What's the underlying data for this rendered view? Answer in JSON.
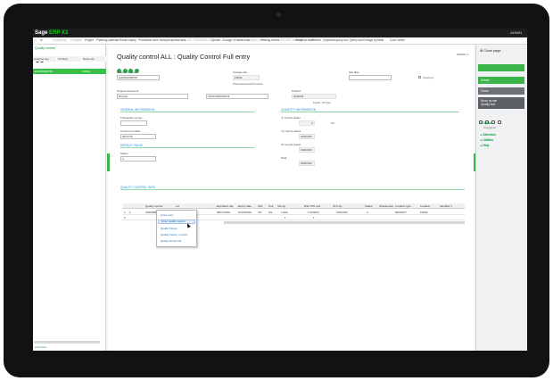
{
  "app": {
    "logo_prefix": "Sage",
    "logo_suffix": "ERP X3",
    "user": "ADMIN"
  },
  "menu": [
    {
      "label": "Customers",
      "dim": true
    },
    {
      "label": "Products",
      "dim": true
    },
    {
      "label": "Project",
      "dim": false
    },
    {
      "label": "Planning calendar",
      "dim": false
    },
    {
      "label": "Route inquiry",
      "dim": false
    },
    {
      "label": "Production work history",
      "dim": false
    },
    {
      "label": "Graphical task",
      "dim": false
    },
    {
      "label": "LIST STANDING ON",
      "dim": true
    },
    {
      "label": "Quotes",
      "dim": false
    },
    {
      "label": "Change of warehouse",
      "dim": false
    },
    {
      "label": "Creation data",
      "dim": true
    },
    {
      "label": "Picking tickets",
      "dim": false
    },
    {
      "label": "UPDATE tracking",
      "dim": true
    },
    {
      "label": "Workflow state",
      "dim": false
    },
    {
      "label": "Orders",
      "dim": false
    },
    {
      "label": "Graphical query tool",
      "dim": false
    },
    {
      "label": "Query tool",
      "dim": false
    }
  ],
  "menu_badges": [
    "Change by table",
    "Cost Center"
  ],
  "left_panel": {
    "title": "Quality control",
    "columns": [
      "Analysis req.",
      "Product",
      "Stock site"
    ],
    "selected_row": [
      "QA0000328709",
      "",
      "FR011"
    ],
    "footer": "Last rows"
  },
  "form": {
    "title": "Quality control ALL : Quality Control Full entry",
    "model_label": "MODEL",
    "analysis_request": {
      "label": "Analysis request",
      "value": "QA0000328709"
    },
    "storage_site": {
      "label": "Storage site",
      "value": "FR011",
      "sub": "Pharmaceutical Products"
    },
    "site_filter": {
      "label": "Site filter",
      "value": "",
      "option": "Inventory"
    },
    "original_document": {
      "label": "Original document",
      "type": "Receipt",
      "value": "FR011R00000278"
    },
    "product": {
      "label": "Product",
      "value": "QG0041",
      "sub": "Liquid - B Type"
    },
    "general_info": "GENERAL INFORMATION",
    "transaction_group": {
      "label": "Transaction group",
      "value": ""
    },
    "control_end_date": {
      "label": "Control end date",
      "value": "04/27/16"
    },
    "default_value": "DEFAULT VALUE",
    "status": {
      "label": "Status",
      "value": "A"
    },
    "quantity_info": "QUANTITY INFORMATION",
    "qty_a": {
      "label": "'A' control status",
      "value": "0",
      "unit": "KG"
    },
    "qty_q": {
      "label": "'Q' control status",
      "value": "1000.000"
    },
    "qty_r": {
      "label": "'R' control status",
      "value": "1000.000"
    },
    "total": {
      "label": "Total",
      "value": "1000.000"
    },
    "grid_section": "QUALITY CONTROL DATA"
  },
  "grid": {
    "columns": [
      "",
      "",
      "Quality control",
      "Lot",
      "Expiration dat",
      "Expiry date",
      "SSL",
      "Unit",
      "Stk qty",
      "RSL STK unit",
      "STK qty",
      "",
      "Status",
      "Checksmail",
      "Location type",
      "Location",
      "Identifier 1"
    ],
    "rows": [
      [
        "1",
        "",
        "A0000887",
        "L1170404203674",
        "08/17/2016",
        "07/29/2016",
        "UN",
        "KG",
        "1.000",
        "1.000000",
        "1000.000",
        "",
        "A",
        "",
        "RECEIPT",
        "FR011",
        ""
      ],
      [
        "2",
        "",
        "",
        "",
        "",
        "",
        "",
        "",
        "1",
        "1",
        "",
        "",
        "",
        "",
        "",
        "",
        ""
      ]
    ]
  },
  "popup": {
    "items": [
      "Lines entry",
      "Enter quality results",
      "Quality history",
      "Quality history / record",
      "Quality kinetic list"
    ],
    "highlight_index": 1
  },
  "right_panel": {
    "close": "Close page",
    "buttons": [
      "",
      "Delete",
      "Close"
    ],
    "dark_lines": [
      "Stock by site",
      "Quality test"
    ],
    "links": [
      {
        "label": "Option",
        "sub": "Navigation"
      },
      {
        "label": "Selection",
        "sub": ""
      },
      {
        "label": "Utilities",
        "sub": ""
      },
      {
        "label": "Help",
        "sub": ""
      }
    ]
  }
}
